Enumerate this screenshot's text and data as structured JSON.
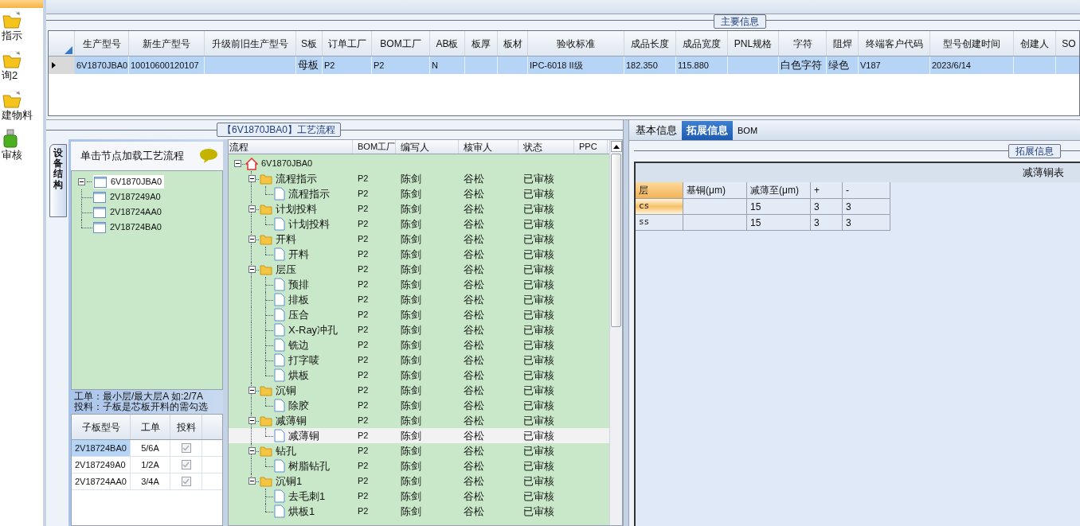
{
  "nav": {
    "items": [
      {
        "label": "指示",
        "kind": "folder"
      },
      {
        "label": "询2",
        "kind": "folder"
      },
      {
        "label": "建物料",
        "kind": "folder"
      },
      {
        "label": "审核",
        "kind": "bin"
      }
    ]
  },
  "main_info": {
    "title": "主要信息",
    "columns": [
      "生产型号",
      "新生产型号",
      "升级前旧生产型号",
      "S板",
      "订单工厂",
      "BOM工厂",
      "AB板",
      "板厚",
      "板材",
      "验收标准",
      "成品长度",
      "成品宽度",
      "PNL规格",
      "字符",
      "阻焊",
      "终端客户代码",
      "型号创建时间",
      "创建人",
      "SO"
    ],
    "rows": [
      {
        "selected": true,
        "cells": [
          "6V1870JBA0",
          "10010600120107",
          null,
          "母板",
          "P2",
          "P2",
          "N",
          null,
          null,
          "IPC-6018 II级",
          "182.350",
          "115.880",
          null,
          "白色字符",
          "绿色",
          "V187",
          "2023/6/14",
          null,
          null
        ]
      }
    ]
  },
  "process": {
    "title": "【6V1870JBA0】工艺流程",
    "side_tab": "设备结构",
    "hint": "单击节点加载工艺流程",
    "structure": {
      "label": "6V1870JBA0",
      "expanded": true,
      "selected": true,
      "children": [
        {
          "label": "2V187249A0",
          "selected": false
        },
        {
          "label": "2V18724AA0",
          "selected": false
        },
        {
          "label": "2V18724BA0",
          "selected": false
        }
      ]
    },
    "notes": [
      "工单：最小层/最大层A 如:2/7A",
      "投料：子板是芯板开料的需勾选"
    ],
    "sub_boards": {
      "columns": [
        "子板型号",
        "工单",
        "投料"
      ],
      "rows": [
        {
          "model": "2V18724BA0",
          "order": "5/6A",
          "checked": true,
          "selected": true
        },
        {
          "model": "2V187249A0",
          "order": "1/2A",
          "checked": true,
          "selected": false
        },
        {
          "model": "2V18724AA0",
          "order": "3/4A",
          "checked": true,
          "selected": false
        }
      ]
    },
    "flow": {
      "columns": [
        "流程",
        "BOM工厂",
        "编写人",
        "核审人",
        "状态",
        "PPC"
      ],
      "root": {
        "label": "6V1870JBA0",
        "expanded": true,
        "selected": false,
        "children": [
          {
            "label": "流程指示",
            "bom_factory": "P2",
            "author": "陈剑",
            "reviewer": "谷松",
            "status": "已审核",
            "expanded": true,
            "selected": false,
            "children": [
              {
                "label": "流程指示",
                "bom_factory": "P2",
                "author": "陈剑",
                "reviewer": "谷松",
                "status": "已审核",
                "selected": false
              }
            ]
          },
          {
            "label": "计划投料",
            "bom_factory": "P2",
            "author": "陈剑",
            "reviewer": "谷松",
            "status": "已审核",
            "expanded": true,
            "selected": false,
            "children": [
              {
                "label": "计划投料",
                "bom_factory": "P2",
                "author": "陈剑",
                "reviewer": "谷松",
                "status": "已审核",
                "selected": false
              }
            ]
          },
          {
            "label": "开料",
            "bom_factory": "P2",
            "author": "陈剑",
            "reviewer": "谷松",
            "status": "已审核",
            "expanded": true,
            "selected": false,
            "children": [
              {
                "label": "开料",
                "bom_factory": "P2",
                "author": "陈剑",
                "reviewer": "谷松",
                "status": "已审核",
                "selected": false
              }
            ]
          },
          {
            "label": "层压",
            "bom_factory": "P2",
            "author": "陈剑",
            "reviewer": "谷松",
            "status": "已审核",
            "expanded": true,
            "selected": false,
            "children": [
              {
                "label": "预排",
                "bom_factory": "P2",
                "author": "陈剑",
                "reviewer": "谷松",
                "status": "已审核",
                "selected": false
              },
              {
                "label": "排板",
                "bom_factory": "P2",
                "author": "陈剑",
                "reviewer": "谷松",
                "status": "已审核",
                "selected": false
              },
              {
                "label": "压合",
                "bom_factory": "P2",
                "author": "陈剑",
                "reviewer": "谷松",
                "status": "已审核",
                "selected": false
              },
              {
                "label": "X-Ray冲孔",
                "bom_factory": "P2",
                "author": "陈剑",
                "reviewer": "谷松",
                "status": "已审核",
                "selected": false
              },
              {
                "label": "铣边",
                "bom_factory": "P2",
                "author": "陈剑",
                "reviewer": "谷松",
                "status": "已审核",
                "selected": false
              },
              {
                "label": "打字唛",
                "bom_factory": "P2",
                "author": "陈剑",
                "reviewer": "谷松",
                "status": "已审核",
                "selected": false
              },
              {
                "label": "烘板",
                "bom_factory": "P2",
                "author": "陈剑",
                "reviewer": "谷松",
                "status": "已审核",
                "selected": false
              }
            ]
          },
          {
            "label": "沉铜",
            "bom_factory": "P2",
            "author": "陈剑",
            "reviewer": "谷松",
            "status": "已审核",
            "expanded": true,
            "selected": false,
            "children": [
              {
                "label": "除胶",
                "bom_factory": "P2",
                "author": "陈剑",
                "reviewer": "谷松",
                "status": "已审核",
                "selected": false
              }
            ]
          },
          {
            "label": "减薄铜",
            "bom_factory": "P2",
            "author": "陈剑",
            "reviewer": "谷松",
            "status": "已审核",
            "expanded": true,
            "selected": false,
            "children": [
              {
                "label": "减薄铜",
                "bom_factory": "P2",
                "author": "陈剑",
                "reviewer": "谷松",
                "status": "已审核",
                "selected": true
              }
            ]
          },
          {
            "label": "钻孔",
            "bom_factory": "P2",
            "author": "陈剑",
            "reviewer": "谷松",
            "status": "已审核",
            "expanded": true,
            "selected": false,
            "children": [
              {
                "label": "树脂钻孔",
                "bom_factory": "P2",
                "author": "陈剑",
                "reviewer": "谷松",
                "status": "已审核",
                "selected": false
              }
            ]
          },
          {
            "label": "沉铜1",
            "bom_factory": "P2",
            "author": "陈剑",
            "reviewer": "谷松",
            "status": "已审核",
            "expanded": true,
            "selected": false,
            "children": [
              {
                "label": "去毛刺1",
                "bom_factory": "P2",
                "author": "陈剑",
                "reviewer": "谷松",
                "status": "已审核",
                "selected": false
              },
              {
                "label": "烘板1",
                "bom_factory": "P2",
                "author": "陈剑",
                "reviewer": "谷松",
                "status": "已审核",
                "selected": false
              }
            ]
          }
        ]
      }
    }
  },
  "detail": {
    "tabs": [
      {
        "label": "基本信息",
        "selected": false
      },
      {
        "label": "拓展信息",
        "selected": true
      },
      {
        "label": "BOM",
        "selected": false
      }
    ],
    "group_title": "拓展信息",
    "table": {
      "title": "减薄铜表",
      "columns": [
        "层",
        "基铜(μm)",
        "减薄至(μm)",
        "+",
        "-"
      ],
      "rows": [
        {
          "selected": true,
          "cells": [
            "cs",
            null,
            "15",
            "3",
            "3"
          ]
        },
        {
          "selected": false,
          "cells": [
            "ss",
            null,
            "15",
            "3",
            "3"
          ]
        }
      ]
    }
  }
}
